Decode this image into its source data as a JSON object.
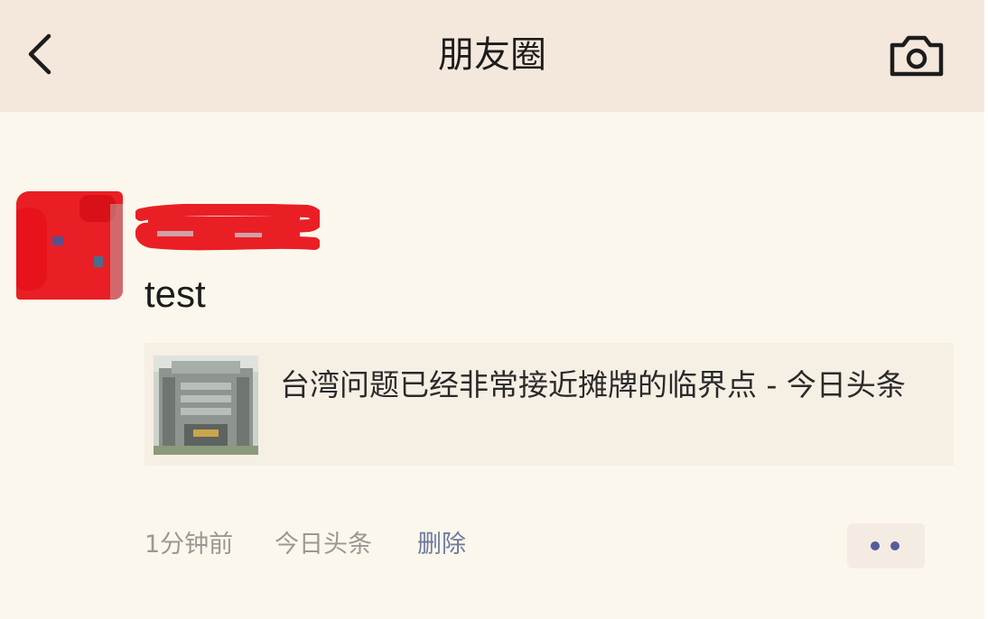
{
  "nav": {
    "title": "朋友圈",
    "back_icon": "chevron-left-icon",
    "camera_icon": "camera-icon"
  },
  "post": {
    "text": "test",
    "link_card": {
      "title": "台湾问题已经非常接近摊牌的临界点 - 今日头条"
    },
    "meta": {
      "time": "1分钟前",
      "source": "今日头条",
      "delete_label": "删除"
    },
    "more_icon": "more-dots-icon"
  },
  "colors": {
    "nav_background": "#f4e8dc",
    "page_background": "#fbf7ec",
    "redaction": "#ea1f26",
    "delete_link": "#6e7aa0",
    "more_dots": "#545d9a"
  }
}
